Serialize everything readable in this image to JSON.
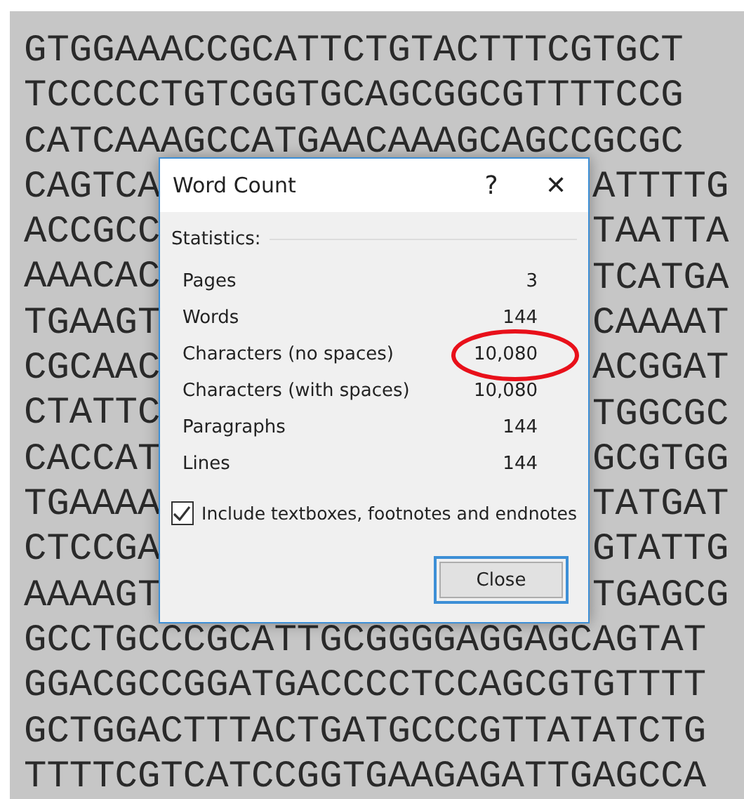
{
  "document": {
    "lines": [
      {
        "text": "GTGGAAACCGCATTCTGTACTTTCGTGCT"
      },
      {
        "text": "TCCCCCTGTCGGTGCAGCGGCGTTTTCCG"
      },
      {
        "text": "CATCAAAGCCATGAACAAAGCAGCCGCGC"
      },
      {
        "left": "CAGTCA",
        "right": "ATTTTG"
      },
      {
        "left": "ACCGCC",
        "right": "TAATTA"
      },
      {
        "left": "AAACAC",
        "right": "TCATGA"
      },
      {
        "left": "TGAAGT",
        "right": "CAAAAT"
      },
      {
        "left": "CGCAAC",
        "right": "ACGGAT"
      },
      {
        "left": "CTATTC",
        "right": "TGGCGC"
      },
      {
        "left": "CACCAT",
        "right": "GCGTGG"
      },
      {
        "left": "TGAAAA",
        "right": "TATGAT"
      },
      {
        "left": "CTCCGA",
        "right": "GTATTG"
      },
      {
        "left": "AAAAGT",
        "right": "TGAGCG"
      },
      {
        "text": "GCCTGCCCGCATTGCGGGGAGGAGCAGTAT"
      },
      {
        "text": "GGACGCCGGATGACCCCTCCAGCGTGTTTT"
      },
      {
        "text": "GCTGGACTTTACTGATGCCCGTTATATCTG"
      },
      {
        "text": "TTTTCGTCATCCGGTGAAGAGATTGAGCCA"
      }
    ]
  },
  "dialog": {
    "title": "Word Count",
    "help": "?",
    "close_glyph": "✕",
    "section": "Statistics:",
    "stats": [
      {
        "label": "Pages",
        "value": "3"
      },
      {
        "label": "Words",
        "value": "144"
      },
      {
        "label": "Characters (no spaces)",
        "value": "10,080",
        "circled": true
      },
      {
        "label": "Characters (with spaces)",
        "value": "10,080"
      },
      {
        "label": "Paragraphs",
        "value": "144"
      },
      {
        "label": "Lines",
        "value": "144"
      }
    ],
    "include_option": {
      "label": "Include textboxes, footnotes and endnotes",
      "checked": true
    },
    "buttons": [
      {
        "label": "Close",
        "default": true
      }
    ]
  }
}
